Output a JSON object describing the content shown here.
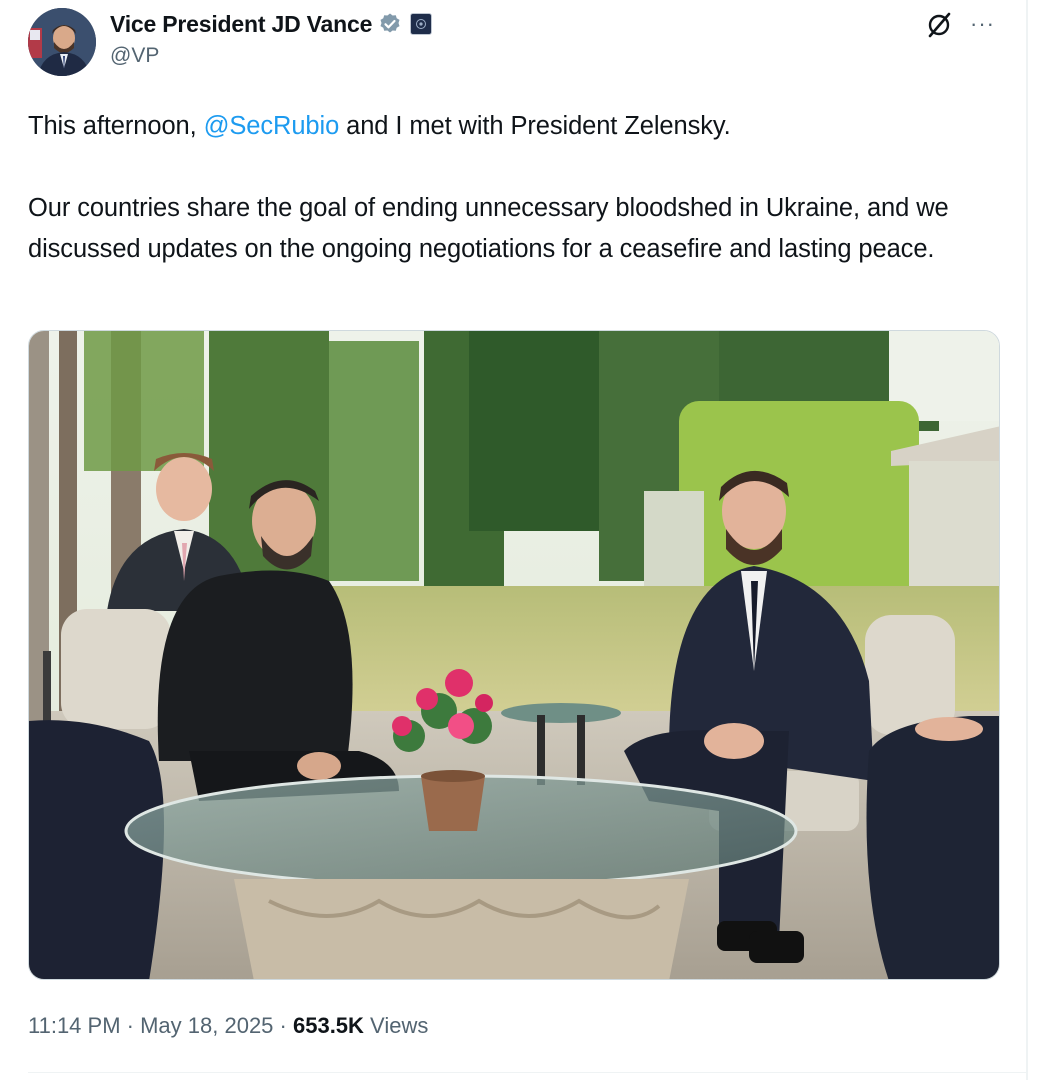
{
  "author": {
    "display_name": "Vice President JD Vance",
    "handle": "@VP",
    "verified_icon": "verified-badge-icon",
    "affiliation_icon": "government-badge-icon"
  },
  "actions": {
    "grok_icon": "grok-icon",
    "more_label": "···"
  },
  "tweet": {
    "line1_before": "This afternoon, ",
    "line1_mention": "@SecRubio",
    "line1_after": " and I met with President Zelensky.",
    "paragraph2": "Our countries share the goal of ending unnecessary bloodshed in Ukraine, and we discussed updates on the ongoing negotiations for a ceasefire and lasting peace."
  },
  "meta": {
    "time": "11:14 PM",
    "separator1": " · ",
    "date": "May 18, 2025",
    "separator2": " · ",
    "views_count": "653.5K",
    "views_label": " Views"
  },
  "colors": {
    "link": "#1d9bf0",
    "secondary_text": "#536471",
    "primary_text": "#0f1419",
    "verified": "#829aab"
  }
}
